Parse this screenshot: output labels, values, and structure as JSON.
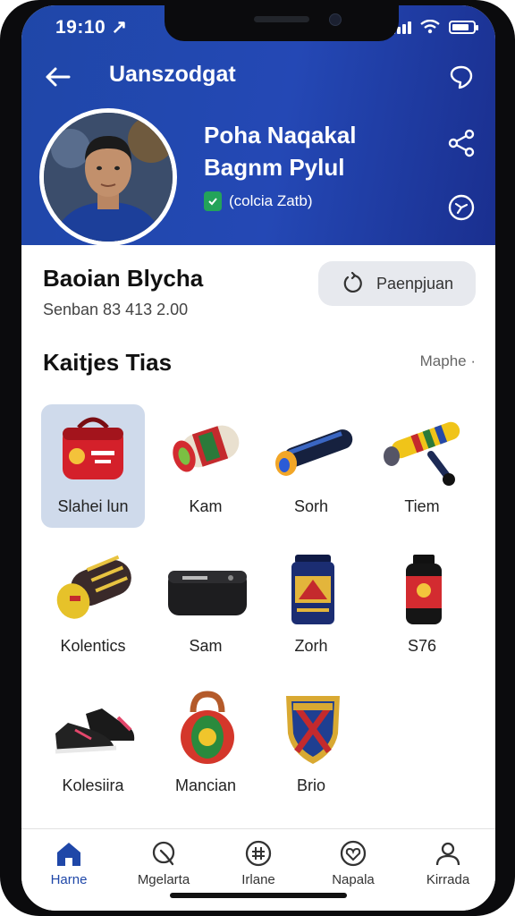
{
  "status": {
    "time": "19:10 ↗"
  },
  "appbar": {
    "title": "Uanszodgat"
  },
  "profile": {
    "name_line1": "Poha Naqakal",
    "name_line2": "Bagnm Pylul",
    "verified_label": "(colcia Zatb)"
  },
  "section": {
    "title": "Baoian Blycha",
    "subtitle": "Senban 83 413 2.00",
    "action_label": "Paenpjuan"
  },
  "grid": {
    "title": "Kaitjes Tias",
    "more_label": "Maphe ·",
    "items": [
      {
        "label": "Slahei lun"
      },
      {
        "label": "Kam"
      },
      {
        "label": "Sorh"
      },
      {
        "label": "Tiem"
      },
      {
        "label": "Kolentics"
      },
      {
        "label": "Sam"
      },
      {
        "label": "Zorh"
      },
      {
        "label": "S76"
      },
      {
        "label": "Kolesiira"
      },
      {
        "label": "Mancian"
      },
      {
        "label": "Brio"
      }
    ]
  },
  "tabs": [
    {
      "label": "Harne"
    },
    {
      "label": "Mgelarta"
    },
    {
      "label": "Irlane"
    },
    {
      "label": "Napala"
    },
    {
      "label": "Kirrada"
    }
  ],
  "colors": {
    "header": "#1f47a8",
    "active": "#1f47a8",
    "selected_bg": "#cfdaeb"
  }
}
